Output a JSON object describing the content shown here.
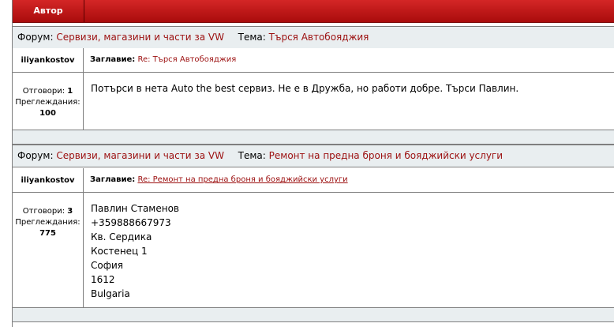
{
  "header": {
    "author_label": "Автор"
  },
  "posts": [
    {
      "forum_label": "Форум:",
      "forum_name": "Сервизи, магазини и части за VW",
      "topic_label": "Тема:",
      "topic_name": "Търся Автобояджия",
      "author": "iliyankostov",
      "title_label": "Заглавие:",
      "title": "Re: Търся Автобояджия",
      "replies_label": "Отговори:",
      "replies": "1",
      "views_label": "Преглеждания:",
      "views": "100",
      "message_lines": [
        "Потърси в нета Auto the best сервиз. Не е в Дружба, но работи добре. Търси Павлин."
      ]
    },
    {
      "forum_label": "Форум:",
      "forum_name": "Сервизи, магазини и части за VW",
      "topic_label": "Тема:",
      "topic_name": "Ремонт на предна броня и бояджийски услуги",
      "author": "iliyankostov",
      "title_label": "Заглавие:",
      "title": "Re: Ремонт на предна броня и бояджийски услуги",
      "replies_label": "Отговори:",
      "replies": "3",
      "views_label": "Преглеждания:",
      "views": "775",
      "message_lines": [
        "Павлин Стаменов",
        "+359888667973",
        "Кв. Сердика",
        "Костенец 1",
        "София",
        "1612",
        "Bulgaria"
      ]
    }
  ],
  "colors": {
    "header_red": "#c41a1a",
    "link_red": "#9c1010",
    "row_gray": "#e9eef0",
    "border": "#7f7f7f"
  }
}
